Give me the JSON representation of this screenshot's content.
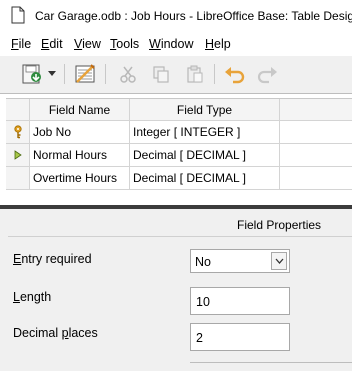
{
  "window": {
    "title": "Car Garage.odb : Job Hours - LibreOffice Base: Table Design"
  },
  "menubar": {
    "items": [
      {
        "label": "File",
        "accel": "F",
        "rest": "ile"
      },
      {
        "label": "Edit",
        "accel": "E",
        "rest": "dit"
      },
      {
        "label": "View",
        "accel": "V",
        "rest": "iew"
      },
      {
        "label": "Tools",
        "accel": "T",
        "rest": "ools"
      },
      {
        "label": "Window",
        "accel": "W",
        "rest": "indow"
      },
      {
        "label": "Help",
        "accel": "H",
        "rest": "elp"
      }
    ]
  },
  "toolbar": {
    "icons": [
      "save-icon",
      "dropdown-arrow-icon",
      "index-design-icon",
      "cut-icon",
      "copy-icon",
      "paste-icon",
      "undo-icon",
      "redo-icon"
    ],
    "colors": {
      "save": "#2e8b3e",
      "undo": "#e8a33a",
      "disabled": "#b8b8b8"
    }
  },
  "table": {
    "headers": {
      "field_name": "Field Name",
      "field_type": "Field Type"
    },
    "rows": [
      {
        "marker": "primary-key-icon",
        "name": "Job No",
        "type": "Integer [ INTEGER ]"
      },
      {
        "marker": "current-row-arrow-icon",
        "name": "Normal Hours",
        "type": "Decimal [ DECIMAL ]"
      },
      {
        "marker": "",
        "name": "Overtime Hours",
        "type": "Decimal [ DECIMAL ]"
      }
    ]
  },
  "properties": {
    "title": "Field Properties",
    "entry_required": {
      "label_pre": "",
      "accel": "E",
      "label_post": "ntry required",
      "value": "No"
    },
    "length": {
      "label_pre": "",
      "accel": "L",
      "label_post": "ength",
      "value": "10"
    },
    "decimal_places": {
      "label_pre": "Decimal ",
      "accel": "p",
      "label_post": "laces",
      "value": "2"
    }
  }
}
